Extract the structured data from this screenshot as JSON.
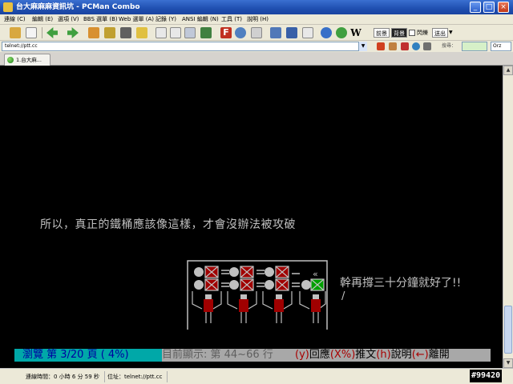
{
  "window": {
    "title": "台大麻麻麻資訊坑 - PCMan Combo",
    "controls": {
      "minimize": "_",
      "maximize": "□",
      "close": "×"
    }
  },
  "menu": [
    "連線 (C)",
    "編輯 (E)",
    "選項 (V)",
    "BBS 選單 (B)",
    "Web 選單 (A)",
    "記錄 (Y)",
    "ANSI 編輯 (N)",
    "工具 (T)",
    "說明 (H)"
  ],
  "toolbar": {
    "front_label": "前景",
    "back_label": "背景",
    "flash_label": "閃爍",
    "send_label": "送出"
  },
  "address": {
    "url": "telnet://ptt.cc",
    "search_label": "搜尋：",
    "search_engine": "Orz"
  },
  "tabs": [
    {
      "label": "1.台大麻..."
    }
  ],
  "terminal": {
    "line1": "所以，真正的鐵桶應該像這樣，才會沒辦法被攻破",
    "speech": "幹再撐三十分鐘就好了!!",
    "slash": "/",
    "status_browse": "瀏覽 第 3/20 頁 (  4%)",
    "status_showing": "目前顯示: 第 44~66 行",
    "status_help": {
      "y_key": "(y)",
      "reply": "回應",
      "x_key": "(X%)",
      "push": "推文",
      "h_key": "(h)",
      "help": "說明",
      "left_key": "(←)",
      "leave": "離開"
    }
  },
  "statusbar": {
    "conn_time": "連線時間：0 小時 6 分 59 秒",
    "address": "位址：telnet://ptt.cc"
  },
  "watermark": "#99420",
  "colors": {
    "cyan_bg": "#00a8a8",
    "gray_bg": "#a8a8a8",
    "terminal_bg": "#000000",
    "guard_red": "#a00000",
    "check_green": "#00a000"
  }
}
